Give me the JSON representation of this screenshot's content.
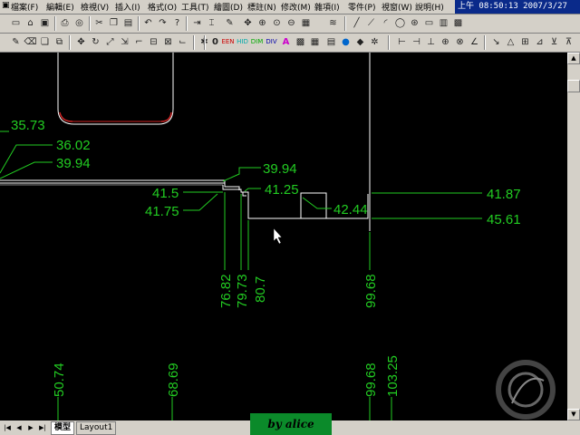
{
  "menu": {
    "items": [
      "檔案(F)",
      "編輯(E)",
      "檢視(V)",
      "插入(I)",
      "格式(O)",
      "工具(T)",
      "繪圖(D)",
      "標註(N)",
      "修改(M)",
      "雜項(I)",
      "零件(P)",
      "視窗(W)",
      "說明(H)"
    ],
    "clock": "上午 08:50:13 2007/3/27"
  },
  "toolbar2": {
    "text_buttons": [
      "0",
      "EEN",
      "HID",
      "DIM",
      "DIV",
      "A"
    ]
  },
  "dimensions": {
    "left_top": "35.73",
    "d36": "36.02",
    "d39a": "39.94",
    "d39b": "39.94",
    "d41_25": "41.25",
    "d41_5": "41.5",
    "d41_75": "41.75",
    "d42_44": "42.44",
    "d41_87": "41.87",
    "d45_61": "45.61",
    "v76": "76.82",
    "v79": "79.73",
    "v80": "80.7",
    "v99a": "99.68",
    "b50": "50.74",
    "b68": "68.69",
    "b99": "99.68",
    "b103": "103.25"
  },
  "tabs": [
    "模型",
    "Layout1"
  ],
  "watermark": "by   alice",
  "colors": {
    "dimension": "#22cc22",
    "geometry": "#ffffff",
    "outline": "#cc2222"
  }
}
